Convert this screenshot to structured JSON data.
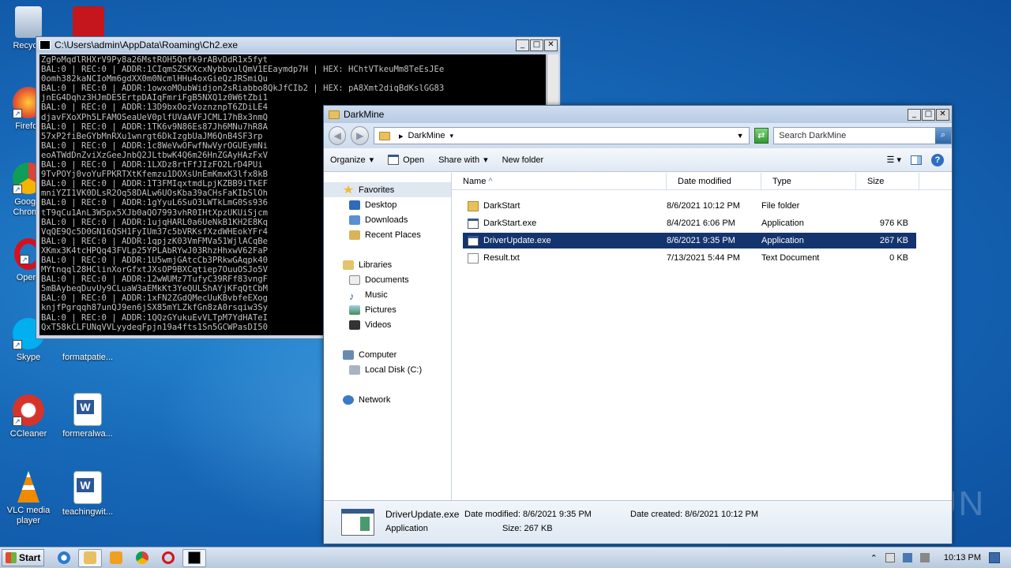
{
  "desktop": {
    "icons": [
      {
        "label": "Recycle"
      },
      {
        "label": "Firefox"
      },
      {
        "label": "Google Chrome"
      },
      {
        "label": "Opera"
      },
      {
        "label": "Skype"
      },
      {
        "label": "formatpatie..."
      },
      {
        "label": "CCleaner"
      },
      {
        "label": "formeralwa..."
      },
      {
        "label": "VLC media player"
      },
      {
        "label": "teachingwit..."
      }
    ],
    "watermark": "ANY RUN"
  },
  "console": {
    "title": "C:\\Users\\admin\\AppData\\Roaming\\Ch2.exe",
    "lines": [
      "ZgPoMqdlRHXrV9Py8a26MstROH5Qnfk9rABvDdR1x5fyt",
      "BAL:0 | REC:0 | ADDR:1CIqmSZSKXcxNybbvulQmV1EEaymdp7H | HEX: HChtVTkeuMm8TeEsJEe",
      "0omh382kaNCIoMm6gdXX0m0NcmlHHu4oxGieQzJRSmiQu",
      "BAL:0 | REC:0 | ADDR:1owxoMOubWidjon2sRiabbo8QkJfCIb2 | HEX: pA8Xmt2diqBdKslGG83",
      "jnEG4Dqhz3HJmDE5ErtpDAIqFmriFgB5NXQ1z0W6tZbi1",
      "BAL:0 | REC:0 | ADDR:13D9bxOozVoznznpT6ZDiLE4",
      "djavFXoXPh5LFAMOSeaUeV0plfUVaAVFJCML17hBx3nmQ",
      "BAL:0 | REC:0 | ADDR:1TK6v9N86Es87Jh6MNu7hR8A",
      "57xP2fiBeGYbMnRXu1wnrgt6DkIzgbUaJM6QnB4SF3rp",
      "BAL:0 | REC:0 | ADDR:1c8WeVwOFwfNwVyrOGUEymNi",
      "eoATWdDnZviXzGeeJnbQ2JLtbwK4Q6m26HnZGAyHAzFxV",
      "BAL:0 | REC:0 | ADDR:1LXDz8rtFfJIzFO2LrD4PUi",
      "9TvPOYj0voYuFPKRTXtKfemzu1DOXsUnEmKmxK3lfx8kB",
      "BAL:0 | REC:0 | ADDR:1T3FMIqxtmdLpjKZBB9iTkEF",
      "mniYZI1VK0DLsR2Oq58DALw6UOsKba39aCHsFaKIbSlOh",
      "BAL:0 | REC:0 | ADDR:1gYyuL6SuO3LWTkLmG0Ss936",
      "tT9qCu1AnL3W5px5XJb0aQO7993vhR0IHtXpzUKUiSjcm",
      "BAL:0 | REC:0 | ADDR:1ujqHARL0a6UeNkB1KH2E8Kq",
      "VqQE9Qc5D0GN16QSH1FyIUm37c5bVRKsfXzdWHEokYFr4",
      "BAL:0 | REC:0 | ADDR:1qpjzK03VmFMVa51WjlACqBe",
      "XKmx3K4tcHPQq43FVLp25YPLAbRYwJ03RhzHhxwV62FaP",
      "BAL:0 | REC:0 | ADDR:1U5wmjGAtcCb3PRkwGAqpk40",
      "MYtnqql28HClinXorGfxtJXsOP9BXCqtiep7OuuOSJo5V",
      "BAL:0 | REC:0 | ADDR:12wWUMz7TufyC39RFf83vngF",
      "5mBAybeqDuvUy9CLuaW3aEMkKt3YeQULShAYjKFqQtCbM",
      "BAL:0 | REC:0 | ADDR:1xFN2ZGdQMecUuKBvbfeEXog",
      "knjfPgrqqh87unQJ9en6jSX85mYLZkfGn8zA0rsqiw3Sy",
      "BAL:0 | REC:0 | ADDR:1QQzGYukuEvVLTpM7YdHATeI",
      "QxT58kCLFUNqVVLyydeqFpjn19a4fts1Sn5GCWPasDI50"
    ]
  },
  "explorer": {
    "title": "DarkMine",
    "address": "DarkMine",
    "search_placeholder": "Search DarkMine",
    "toolbar": {
      "organize": "Organize",
      "open": "Open",
      "share_with": "Share with",
      "new_folder": "New folder"
    },
    "nav": {
      "favorites": "Favorites",
      "desktop": "Desktop",
      "downloads": "Downloads",
      "recent": "Recent Places",
      "libraries": "Libraries",
      "documents": "Documents",
      "music": "Music",
      "pictures": "Pictures",
      "videos": "Videos",
      "computer": "Computer",
      "local_disk": "Local Disk (C:)",
      "network": "Network"
    },
    "columns": {
      "name": "Name",
      "date": "Date modified",
      "type": "Type",
      "size": "Size"
    },
    "files": [
      {
        "name": "DarkStart",
        "date": "8/6/2021 10:12 PM",
        "type": "File folder",
        "size": "",
        "icon": "folder-icon"
      },
      {
        "name": "DarkStart.exe",
        "date": "8/4/2021 6:06 PM",
        "type": "Application",
        "size": "976 KB",
        "icon": "exe-icon"
      },
      {
        "name": "DriverUpdate.exe",
        "date": "8/6/2021 9:35 PM",
        "type": "Application",
        "size": "267 KB",
        "icon": "exe-icon"
      },
      {
        "name": "Result.txt",
        "date": "7/13/2021 5:44 PM",
        "type": "Text Document",
        "size": "0 KB",
        "icon": "text-file-icon"
      }
    ],
    "details": {
      "name": "DriverUpdate.exe",
      "modified": "Date modified:  8/6/2021 9:35 PM",
      "created": "Date created:  8/6/2021 10:12 PM",
      "type": "Application",
      "size": "Size:  267 KB"
    }
  },
  "taskbar": {
    "start": "Start",
    "time": "10:13 PM"
  },
  "colors": {
    "selection": "#14346e",
    "desktop": "#1769b8"
  }
}
